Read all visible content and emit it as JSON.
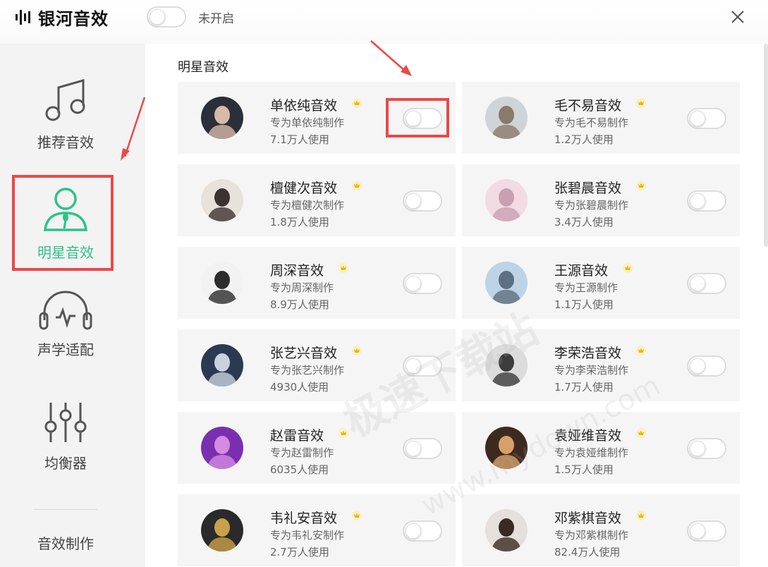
{
  "app": {
    "name": "银河音效",
    "master_status": "未开启"
  },
  "sidebar": {
    "items": [
      {
        "label": "推荐音效",
        "icon": "music-note-icon"
      },
      {
        "label": "明星音效",
        "icon": "user-mic-icon",
        "active": true
      },
      {
        "label": "声学适配",
        "icon": "headphones-icon"
      },
      {
        "label": "均衡器",
        "icon": "equalizer-sliders-icon"
      }
    ],
    "make_label": "音效制作"
  },
  "main": {
    "section_title": "明星音效",
    "cards": [
      {
        "title": "单依纯音效",
        "subtitle": "专为单依纯制作",
        "count": "7.1万人使用",
        "enabled": false
      },
      {
        "title": "毛不易音效",
        "subtitle": "专为毛不易制作",
        "count": "1.2万人使用",
        "enabled": false
      },
      {
        "title": "檀健次音效",
        "subtitle": "专为檀健次制作",
        "count": "1.8万人使用",
        "enabled": false
      },
      {
        "title": "张碧晨音效",
        "subtitle": "专为张碧晨制作",
        "count": "3.4万人使用",
        "enabled": false
      },
      {
        "title": "周深音效",
        "subtitle": "专为周深制作",
        "count": "8.9万人使用",
        "enabled": false
      },
      {
        "title": "王源音效",
        "subtitle": "专为王源制作",
        "count": "1.1万人使用",
        "enabled": false
      },
      {
        "title": "张艺兴音效",
        "subtitle": "专为张艺兴制作",
        "count": "4930人使用",
        "enabled": false
      },
      {
        "title": "李荣浩音效",
        "subtitle": "专为李荣浩制作",
        "count": "1.7万人使用",
        "enabled": false
      },
      {
        "title": "赵雷音效",
        "subtitle": "专为赵雷制作",
        "count": "6035人使用",
        "enabled": false
      },
      {
        "title": "袁娅维音效",
        "subtitle": "专为袁娅维制作",
        "count": "1.5万人使用",
        "enabled": false
      },
      {
        "title": "韦礼安音效",
        "subtitle": "专为韦礼安制作",
        "count": "2.7万人使用",
        "enabled": false
      },
      {
        "title": "邓紫棋音效",
        "subtitle": "专为邓紫棋制作",
        "count": "82.4万人使用",
        "enabled": false
      }
    ]
  },
  "watermark": {
    "text": "极速下载站",
    "url": "www.mydown.com"
  },
  "colors": {
    "accent": "#2ec28a",
    "highlight": "#ec4848",
    "vip": "#e6b817"
  }
}
